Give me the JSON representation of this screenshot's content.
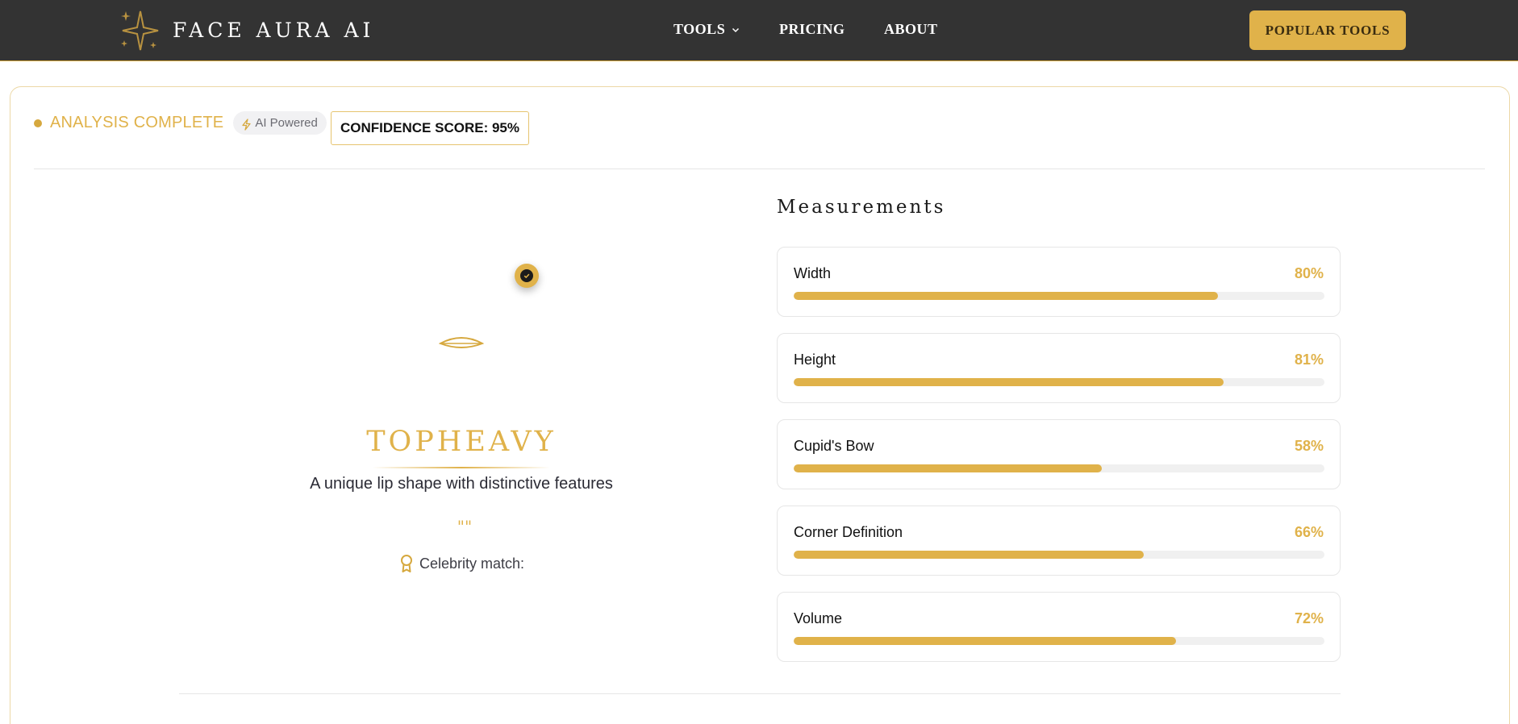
{
  "header": {
    "brand": "FACE AURA AI",
    "nav": {
      "tools": "TOOLS",
      "pricing": "PRICING",
      "about": "ABOUT"
    },
    "cta": "POPULAR TOOLS"
  },
  "status": {
    "text": "ANALYSIS COMPLETE",
    "badge": "AI Powered",
    "confidence": "CONFIDENCE SCORE: 95%"
  },
  "result": {
    "shape": "TOPHEAVY",
    "description": "A unique lip shape with distinctive features",
    "quote": "\"\"",
    "celebrity_label": "Celebrity match:"
  },
  "measurements": {
    "heading": "Measurements",
    "items": [
      {
        "label": "Width",
        "value": "80%",
        "level": 0.8
      },
      {
        "label": "Height",
        "value": "81%",
        "level": 0.81
      },
      {
        "label": "Cupid's Bow",
        "value": "58%",
        "level": 0.58
      },
      {
        "label": "Corner Definition",
        "value": "66%",
        "level": 0.66
      },
      {
        "label": "Volume",
        "value": "72%",
        "level": 0.72
      }
    ]
  },
  "colors": {
    "accent": "#e0b24a",
    "header_bg": "#333333"
  }
}
